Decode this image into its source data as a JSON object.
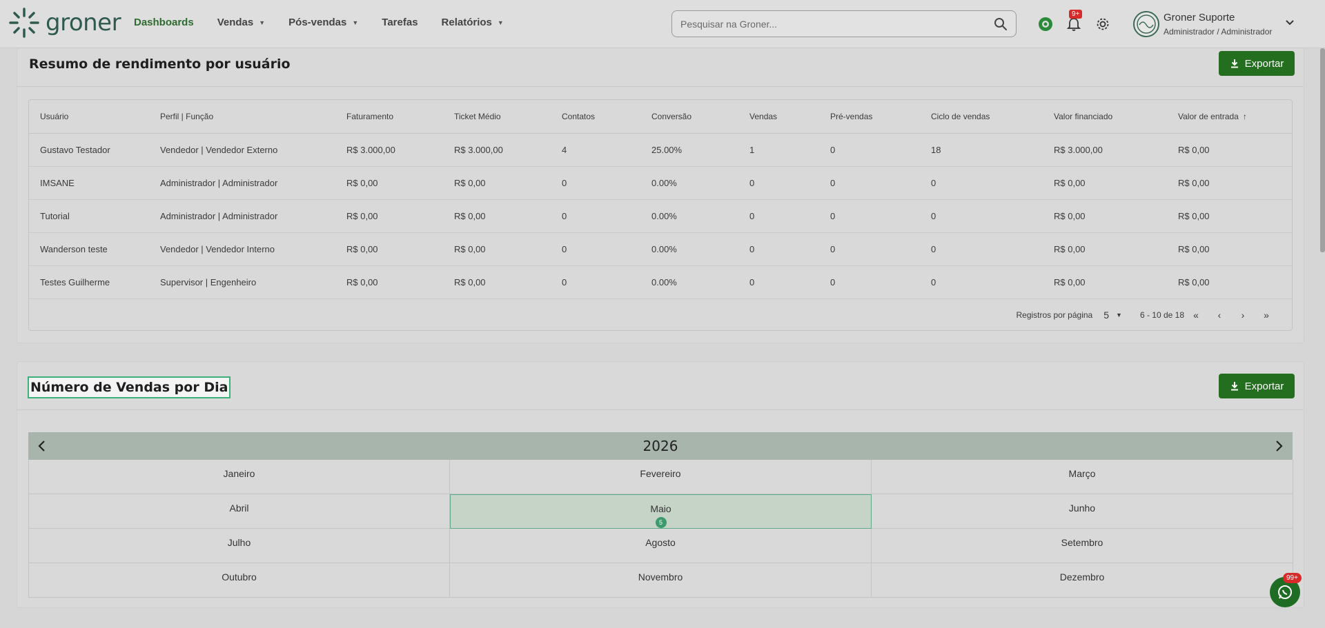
{
  "brand": {
    "name": "groner",
    "accent": "#236f1f"
  },
  "nav": {
    "items": [
      {
        "label": "Dashboards",
        "active": true,
        "dropdown": false
      },
      {
        "label": "Vendas",
        "active": false,
        "dropdown": true
      },
      {
        "label": "Pós-vendas",
        "active": false,
        "dropdown": true
      },
      {
        "label": "Tarefas",
        "active": false,
        "dropdown": false
      },
      {
        "label": "Relatórios",
        "active": false,
        "dropdown": true
      }
    ]
  },
  "search": {
    "placeholder": "Pesquisar na Groner...",
    "value": ""
  },
  "notifications": {
    "badge": "9+"
  },
  "user": {
    "name": "Groner Suporte",
    "role": "Administrador / Administrador"
  },
  "performance": {
    "title": "Resumo de rendimento por usuário",
    "export_label": "Exportar",
    "columns": [
      "Usuário",
      "Perfil | Função",
      "Faturamento",
      "Ticket Médio",
      "Contatos",
      "Conversão",
      "Vendas",
      "Pré-vendas",
      "Ciclo de vendas",
      "Valor financiado",
      "Valor de entrada"
    ],
    "rows": [
      [
        "Gustavo Testador",
        "Vendedor | Vendedor Externo",
        "R$ 3.000,00",
        "R$ 3.000,00",
        "4",
        "25.00%",
        "1",
        "0",
        "18",
        "R$ 3.000,00",
        "R$ 0,00"
      ],
      [
        "IMSANE",
        "Administrador | Administrador",
        "R$ 0,00",
        "R$ 0,00",
        "0",
        "0.00%",
        "0",
        "0",
        "0",
        "R$ 0,00",
        "R$ 0,00"
      ],
      [
        "Tutorial",
        "Administrador | Administrador",
        "R$ 0,00",
        "R$ 0,00",
        "0",
        "0.00%",
        "0",
        "0",
        "0",
        "R$ 0,00",
        "R$ 0,00"
      ],
      [
        "Wanderson teste",
        "Vendedor | Vendedor Interno",
        "R$ 0,00",
        "R$ 0,00",
        "0",
        "0.00%",
        "0",
        "0",
        "0",
        "R$ 0,00",
        "R$ 0,00"
      ],
      [
        "Testes Guilherme",
        "Supervisor | Engenheiro",
        "R$ 0,00",
        "R$ 0,00",
        "0",
        "0.00%",
        "0",
        "0",
        "0",
        "R$ 0,00",
        "R$ 0,00"
      ]
    ],
    "pagination": {
      "per_page_label": "Registros por página",
      "per_page": "5",
      "range": "6 - 10 de 18"
    }
  },
  "sales_by_day": {
    "title": "Número de Vendas por Dia",
    "export_label": "Exportar",
    "year": "2026",
    "months": [
      {
        "label": "Janeiro"
      },
      {
        "label": "Fevereiro"
      },
      {
        "label": "Março"
      },
      {
        "label": "Abril"
      },
      {
        "label": "Maio",
        "count": "5",
        "selected": true
      },
      {
        "label": "Junho"
      },
      {
        "label": "Julho"
      },
      {
        "label": "Agosto"
      },
      {
        "label": "Setembro"
      },
      {
        "label": "Outubro"
      },
      {
        "label": "Novembro"
      },
      {
        "label": "Dezembro"
      }
    ]
  },
  "whatsapp": {
    "badge": "99+"
  }
}
